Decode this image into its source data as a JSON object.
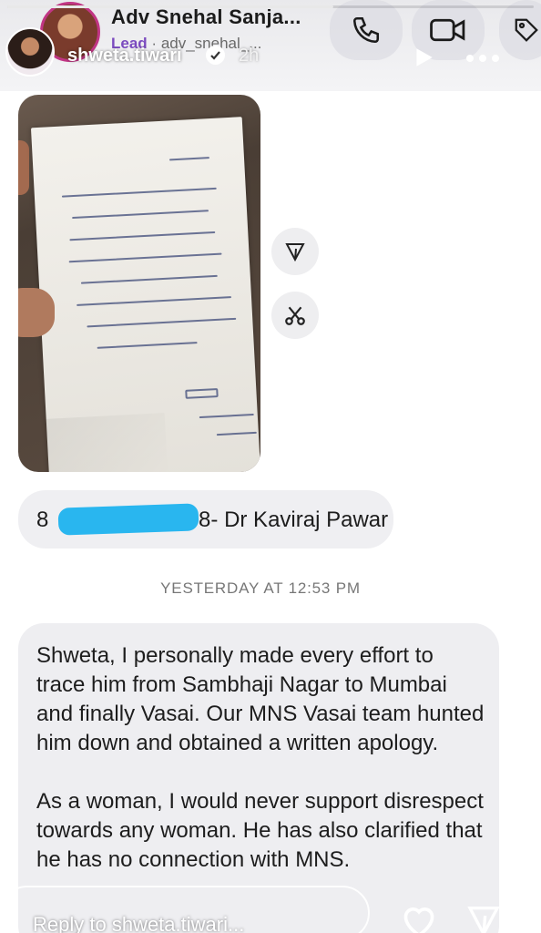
{
  "chat_header": {
    "title": "Adv Snehal Sanja...",
    "badge": "Lead",
    "username": "adv_snehal_..."
  },
  "story": {
    "username": "shweta.tiwari",
    "time_ago": "2h"
  },
  "contact_message": {
    "prefix": "8",
    "suffix": "808- Dr Kaviraj Pawar"
  },
  "timestamp": "YESTERDAY AT 12:53 PM",
  "message": {
    "paragraph1": "Shweta, I personally made every effort to trace him from Sambhaji Nagar to Mumbai and finally Vasai. Our MNS Vasai team hunted him down and obtained a written apology.",
    "paragraph2": "As a woman, I would never support disrespect towards any woman. He has also clarified that he has no connection with MNS."
  },
  "reply": {
    "placeholder": "Reply to shweta.tiwari..."
  },
  "icons": {
    "call": "phone-icon",
    "video": "video-camera-icon",
    "tag": "tag-icon",
    "play": "play-icon",
    "more": "more-icon",
    "forward": "forward-icon",
    "cut": "scissors-icon",
    "like": "heart-icon",
    "send": "send-icon"
  },
  "colors": {
    "lead_badge": "#7b4bbf",
    "redaction": "#29b6ef",
    "bubble": "#eeeef1"
  }
}
